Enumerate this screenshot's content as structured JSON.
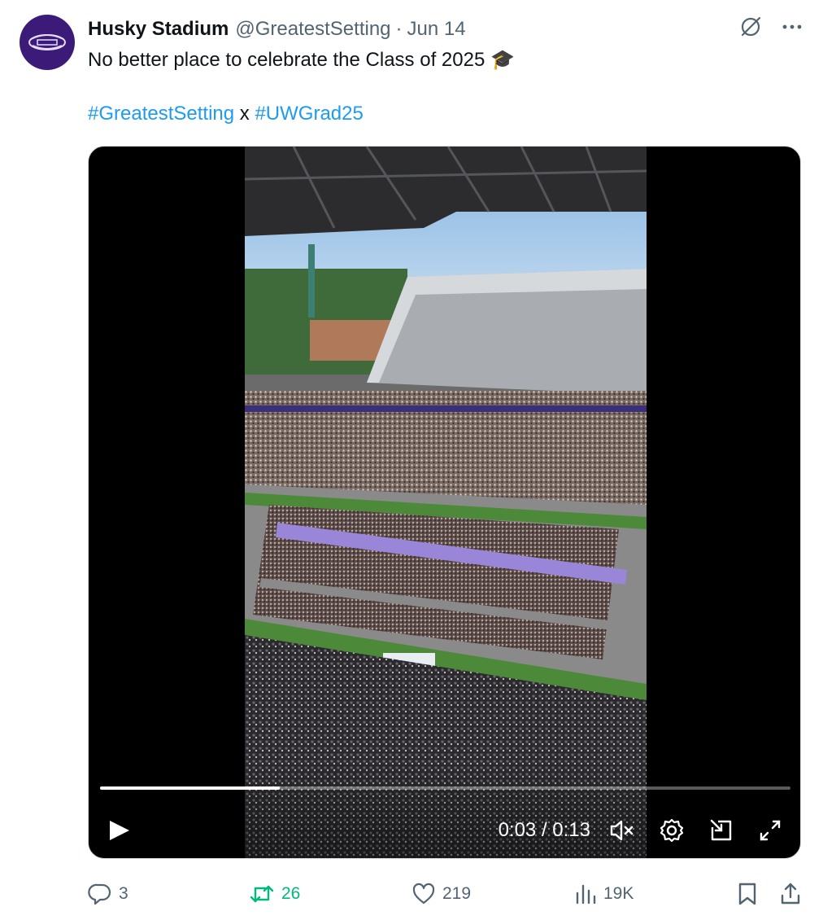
{
  "tweet": {
    "display_name": "Husky Stadium",
    "handle": "@GreatestSetting",
    "separator": "·",
    "date": "Jun 14",
    "text_line1": "No better place to celebrate the Class of 2025",
    "emoji": "🎓",
    "hashtag1": "#GreatestSetting",
    "joiner": " x ",
    "hashtag2": "#UWGrad25"
  },
  "video": {
    "current_time": "0:03",
    "duration": "0:13",
    "time_label": "0:03 / 0:13",
    "progress": 0.26,
    "muted": true
  },
  "actions": {
    "replies": "3",
    "reposts": "26",
    "likes": "219",
    "views": "19K"
  },
  "colors": {
    "link": "#1d9bf0",
    "repost_active": "#00ba7c",
    "muted_text": "#536471",
    "avatar_bg": "#3b1a78"
  },
  "icons": {
    "top": [
      "grok-icon",
      "more-icon"
    ],
    "video_controls": [
      "play-icon",
      "volume-muted-icon",
      "settings-gear-icon",
      "pip-icon",
      "fullscreen-icon"
    ],
    "actions": [
      "reply-icon",
      "repost-icon",
      "like-icon",
      "views-icon",
      "bookmark-icon",
      "share-icon"
    ]
  }
}
